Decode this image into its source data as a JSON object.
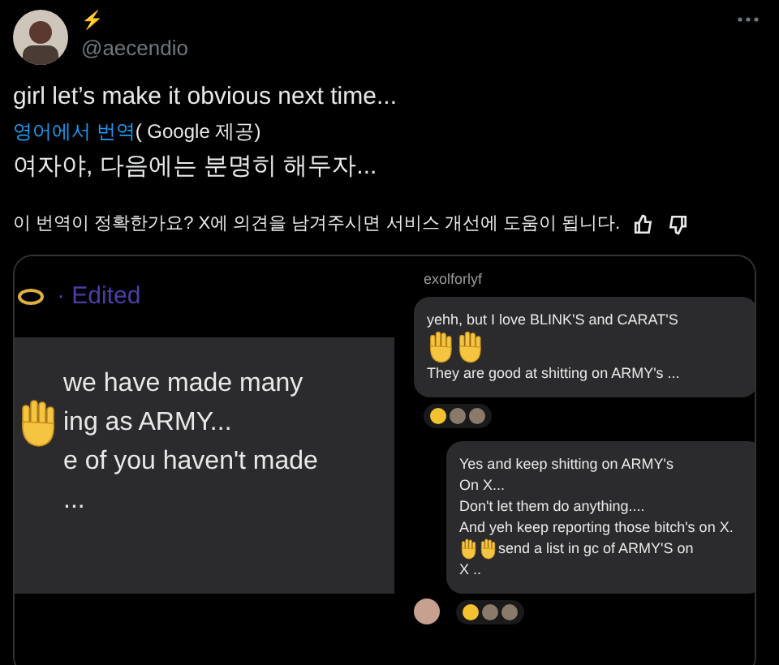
{
  "author": {
    "name": "⚡",
    "handle": "@aecendio"
  },
  "tweet_text": "girl let’s make it obvious next time...",
  "translation": {
    "link": "영어에서 번역",
    "provider": "( Google 제공)",
    "text": "여자야, 다음에는 분명히 해두자..."
  },
  "feedback": {
    "question": "이 번역이 정확한가요? X에 의견을 남겨주시면 서비스 개선에 도움이 됩니다."
  },
  "media": {
    "left": {
      "edited": "· Edited",
      "lines": [
        "we have made many",
        "ing as ARMY...",
        "e of you haven't made",
        "..."
      ]
    },
    "right": {
      "username": "exolforlyf",
      "messages": [
        {
          "lines": [
            "yehh, but I love BLINK'S and CARAT'S",
            "They are good at shitting on ARMY's ..."
          ],
          "avatar": false
        },
        {
          "lines": [
            "Yes and keep shitting on ARMY's",
            "On X...",
            "Don't let them do anything....",
            "And yeh keep reporting those bitch's on X.",
            "send a list in gc of ARMY'S on",
            "X .."
          ],
          "avatar": true
        }
      ]
    }
  }
}
